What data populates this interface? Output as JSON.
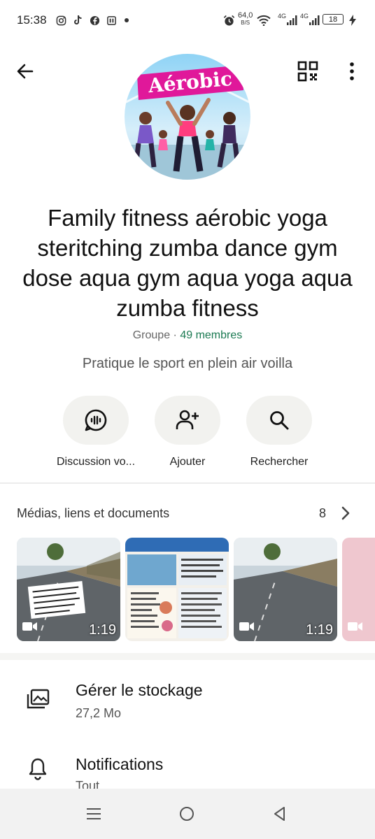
{
  "status_bar": {
    "time": "15:38",
    "net_speed_value": "64,0",
    "net_speed_unit": "B/S",
    "signal_1": "4G",
    "signal_2": "4G",
    "battery": "18"
  },
  "top_bar": {
    "back_icon": "arrow-left-icon",
    "qr_icon": "qr-code-icon",
    "more_icon": "more-vertical-icon"
  },
  "avatar": {
    "badge_text": "Aérobic"
  },
  "group": {
    "title": "Family fitness aérobic yoga steritching  zumba dance  gym dose aqua gym aqua yoga aqua zumba fitness",
    "type": "Groupe",
    "separator": " · ",
    "members": "49 membres",
    "description": "Pratique le sport en plein air voilla"
  },
  "actions": [
    {
      "label": "Discussion vo...",
      "icon": "voice-chat-icon"
    },
    {
      "label": "Ajouter",
      "icon": "add-user-icon"
    },
    {
      "label": "Rechercher",
      "icon": "search-icon"
    }
  ],
  "media": {
    "title": "Médias, liens et documents",
    "count": "8",
    "thumbnails": [
      {
        "type": "video",
        "duration": "1:19"
      },
      {
        "type": "image"
      },
      {
        "type": "video",
        "duration": "1:19"
      },
      {
        "type": "video"
      }
    ]
  },
  "settings": [
    {
      "title": "Gérer le stockage",
      "subtitle": "27,2 Mo",
      "icon": "storage-icon"
    },
    {
      "title": "Notifications",
      "subtitle": "Tout",
      "icon": "bell-icon"
    }
  ],
  "colors": {
    "accent_green": "#1b7a52",
    "action_bg": "#f2f2ef",
    "badge_magenta": "#e0189a"
  }
}
